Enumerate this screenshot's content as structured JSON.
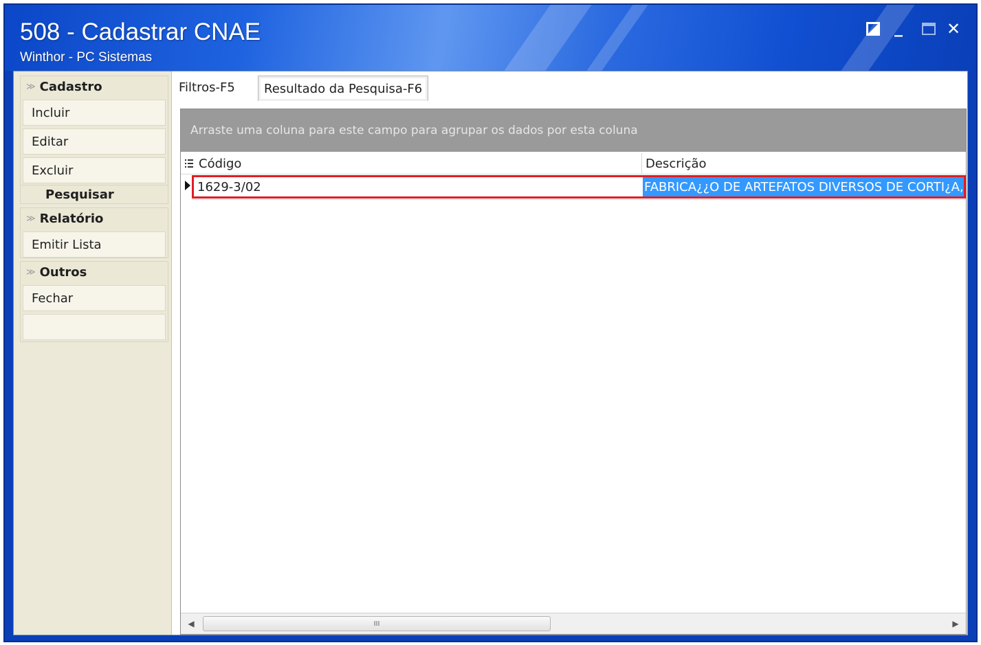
{
  "window": {
    "title": "508 - Cadastrar CNAE",
    "subtitle": "Winthor - PC Sistemas",
    "controls": {
      "restore_icon": "restore-icon",
      "minimize_label": "_",
      "maximize_icon": "maximize-icon",
      "close_label": "✕"
    }
  },
  "sidebar": {
    "groups": [
      {
        "title": "Cadastro",
        "items": [
          "Incluir",
          "Editar",
          "Excluir"
        ]
      },
      {
        "title": "Relatório",
        "items": [
          "Emitir Lista"
        ]
      },
      {
        "title": "Outros",
        "items": [
          "Fechar",
          ""
        ]
      }
    ],
    "search_label": "Pesquisar"
  },
  "tabs": [
    {
      "label": "Filtros-F5",
      "active": false
    },
    {
      "label": "Resultado da Pesquisa-F6",
      "active": true
    }
  ],
  "grid": {
    "group_hint": "Arraste uma coluna para este campo para agrupar os dados por esta coluna",
    "columns": [
      "Código",
      "Descrição"
    ],
    "rows": [
      {
        "codigo": "1629-3/02",
        "descricao": "FABRICA¿¿O DE ARTEFATOS DIVERSOS DE CORTI¿A,"
      }
    ],
    "scroll_thumb_label": "III"
  },
  "colors": {
    "titlebar": "#1f63e0",
    "selection": "#3399ff",
    "highlight_border": "#e01c24",
    "group_bar": "#9a9a9a"
  }
}
